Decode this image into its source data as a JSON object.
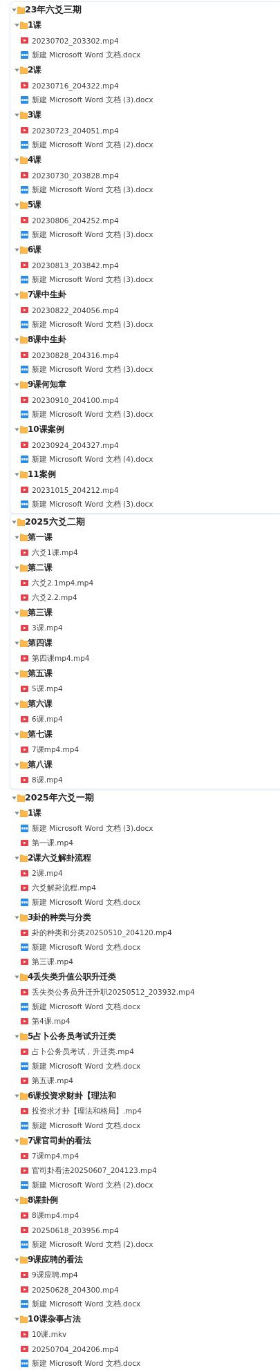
{
  "tree": [
    {
      "kind": "folder",
      "name": "23年六爻三期",
      "expanded": true,
      "framed": true,
      "children": [
        {
          "kind": "folder",
          "name": "1课",
          "expanded": true,
          "children": [
            {
              "kind": "video",
              "name": "20230702_203302.mp4"
            },
            {
              "kind": "doc",
              "name": "新建 Microsoft Word 文档.docx"
            }
          ]
        },
        {
          "kind": "folder",
          "name": "2课",
          "expanded": true,
          "children": [
            {
              "kind": "video",
              "name": "20230716_204322.mp4"
            },
            {
              "kind": "doc",
              "name": "新建 Microsoft Word 文档 (3).docx"
            }
          ]
        },
        {
          "kind": "folder",
          "name": "3课",
          "expanded": true,
          "children": [
            {
              "kind": "video",
              "name": "20230723_204051.mp4"
            },
            {
              "kind": "doc",
              "name": "新建 Microsoft Word 文档 (2).docx"
            }
          ]
        },
        {
          "kind": "folder",
          "name": "4课",
          "expanded": true,
          "children": [
            {
              "kind": "video",
              "name": "20230730_203828.mp4"
            },
            {
              "kind": "doc",
              "name": "新建 Microsoft Word 文档 (3).docx"
            }
          ]
        },
        {
          "kind": "folder",
          "name": "5课",
          "expanded": true,
          "children": [
            {
              "kind": "video",
              "name": "20230806_204252.mp4"
            },
            {
              "kind": "doc",
              "name": "新建 Microsoft Word 文档 (3).docx"
            }
          ]
        },
        {
          "kind": "folder",
          "name": "6课",
          "expanded": true,
          "children": [
            {
              "kind": "video",
              "name": "20230813_203842.mp4"
            },
            {
              "kind": "doc",
              "name": "新建 Microsoft Word 文档 (3).docx"
            }
          ]
        },
        {
          "kind": "folder",
          "name": "7课中生卦",
          "expanded": true,
          "children": [
            {
              "kind": "video",
              "name": "20230822_204056.mp4"
            },
            {
              "kind": "doc",
              "name": "新建 Microsoft Word 文档 (3).docx"
            }
          ]
        },
        {
          "kind": "folder",
          "name": "8课中生卦",
          "expanded": true,
          "children": [
            {
              "kind": "video",
              "name": "20230828_204316.mp4"
            },
            {
              "kind": "doc",
              "name": "新建 Microsoft Word 文档 (3).docx"
            }
          ]
        },
        {
          "kind": "folder",
          "name": "9课何知章",
          "expanded": true,
          "children": [
            {
              "kind": "video",
              "name": "20230910_204100.mp4"
            },
            {
              "kind": "doc",
              "name": "新建 Microsoft Word 文档 (3).docx"
            }
          ]
        },
        {
          "kind": "folder",
          "name": "10课案例",
          "expanded": true,
          "children": [
            {
              "kind": "video",
              "name": "20230924_204327.mp4"
            },
            {
              "kind": "doc",
              "name": "新建 Microsoft Word 文档 (4).docx"
            }
          ]
        },
        {
          "kind": "folder",
          "name": "11案例",
          "expanded": true,
          "children": [
            {
              "kind": "video",
              "name": "20231015_204212.mp4"
            },
            {
              "kind": "doc",
              "name": "新建 Microsoft Word 文档 (3).docx"
            }
          ]
        }
      ]
    },
    {
      "kind": "folder",
      "name": "2025六爻二期",
      "expanded": true,
      "framed": true,
      "children": [
        {
          "kind": "folder",
          "name": "第一课",
          "expanded": true,
          "children": [
            {
              "kind": "video",
              "name": "六爻1课.mp4"
            }
          ]
        },
        {
          "kind": "folder",
          "name": "第二课",
          "expanded": true,
          "children": [
            {
              "kind": "video",
              "name": "六爻2.1mp4.mp4"
            },
            {
              "kind": "video",
              "name": "六爻2.2.mp4"
            }
          ]
        },
        {
          "kind": "folder",
          "name": "第三课",
          "expanded": true,
          "children": [
            {
              "kind": "video",
              "name": "3课.mp4"
            }
          ]
        },
        {
          "kind": "folder",
          "name": "第四课",
          "expanded": true,
          "children": [
            {
              "kind": "video",
              "name": "第四课mp4.mp4"
            }
          ]
        },
        {
          "kind": "folder",
          "name": "第五课",
          "expanded": true,
          "children": [
            {
              "kind": "video",
              "name": "5课.mp4"
            }
          ]
        },
        {
          "kind": "folder",
          "name": "第六课",
          "expanded": true,
          "children": [
            {
              "kind": "video",
              "name": "6课.mp4"
            }
          ]
        },
        {
          "kind": "folder",
          "name": "第七课",
          "expanded": true,
          "children": [
            {
              "kind": "video",
              "name": "7课mp4.mp4"
            }
          ]
        },
        {
          "kind": "folder",
          "name": "第八课",
          "expanded": true,
          "children": [
            {
              "kind": "video",
              "name": "8课.mp4"
            }
          ]
        }
      ]
    },
    {
      "kind": "folder",
      "name": "2025年六爻一期",
      "expanded": true,
      "framed": false,
      "children": [
        {
          "kind": "folder",
          "name": "1课",
          "expanded": true,
          "children": [
            {
              "kind": "doc",
              "name": "新建 Microsoft Word 文档 (3).docx"
            },
            {
              "kind": "video",
              "name": "第一课.mp4"
            }
          ]
        },
        {
          "kind": "folder",
          "name": "2课六爻解卦流程",
          "expanded": true,
          "children": [
            {
              "kind": "video",
              "name": "2课.mp4"
            },
            {
              "kind": "video",
              "name": "六爻解卦流程.mp4"
            },
            {
              "kind": "doc",
              "name": "新建 Microsoft Word 文档.docx"
            }
          ]
        },
        {
          "kind": "folder",
          "name": "3卦的种类与分类",
          "expanded": true,
          "children": [
            {
              "kind": "video",
              "name": "卦的种类和分类20250510_204120.mp4"
            },
            {
              "kind": "doc",
              "name": "新建 Microsoft Word 文档.docx"
            },
            {
              "kind": "video",
              "name": "第三课.mp4"
            }
          ]
        },
        {
          "kind": "folder",
          "name": "4丢失类升值公职升迁类",
          "expanded": true,
          "children": [
            {
              "kind": "video",
              "name": "丢失类公务员升迁升职20250512_203932.mp4"
            },
            {
              "kind": "doc",
              "name": "新建 Microsoft Word 文档.docx"
            },
            {
              "kind": "video",
              "name": "第4课.mp4"
            }
          ]
        },
        {
          "kind": "folder",
          "name": "5占卜公务员考试升迁类",
          "expanded": true,
          "children": [
            {
              "kind": "video",
              "name": "占卜公务员考试，升迁类.mp4"
            },
            {
              "kind": "doc",
              "name": "新建 Microsoft Word 文档.docx"
            },
            {
              "kind": "video",
              "name": "第五课.mp4"
            }
          ]
        },
        {
          "kind": "folder",
          "name": "6课投资求财卦【理法和",
          "expanded": true,
          "children": [
            {
              "kind": "video",
              "name": "投资求才卦【理法和格局】.mp4"
            },
            {
              "kind": "doc",
              "name": "新建 Microsoft Word 文档.docx"
            }
          ]
        },
        {
          "kind": "folder",
          "name": "7课官司卦的看法",
          "expanded": true,
          "children": [
            {
              "kind": "video",
              "name": "7课mp4.mp4"
            },
            {
              "kind": "video",
              "name": "官司卦看法20250607_204123.mp4"
            },
            {
              "kind": "doc",
              "name": "新建 Microsoft Word 文档 (2).docx"
            }
          ]
        },
        {
          "kind": "folder",
          "name": "8课卦例",
          "expanded": true,
          "children": [
            {
              "kind": "video",
              "name": "8课mp4.mp4"
            },
            {
              "kind": "video",
              "name": "20250618_203956.mp4"
            },
            {
              "kind": "doc",
              "name": "新建 Microsoft Word 文档 (2).docx"
            }
          ]
        },
        {
          "kind": "folder",
          "name": "9课应聘的看法",
          "expanded": true,
          "children": [
            {
              "kind": "video",
              "name": "9课应聘.mp4"
            },
            {
              "kind": "video",
              "name": "20250628_204300.mp4"
            },
            {
              "kind": "doc",
              "name": "新建 Microsoft Word 文档.docx"
            }
          ]
        },
        {
          "kind": "folder",
          "name": "10课杂事占法",
          "expanded": true,
          "children": [
            {
              "kind": "video",
              "name": "10课.mkv"
            },
            {
              "kind": "video",
              "name": "20250704_204206.mp4"
            },
            {
              "kind": "doc",
              "name": "新建 Microsoft Word 文档.docx"
            }
          ]
        }
      ]
    }
  ]
}
